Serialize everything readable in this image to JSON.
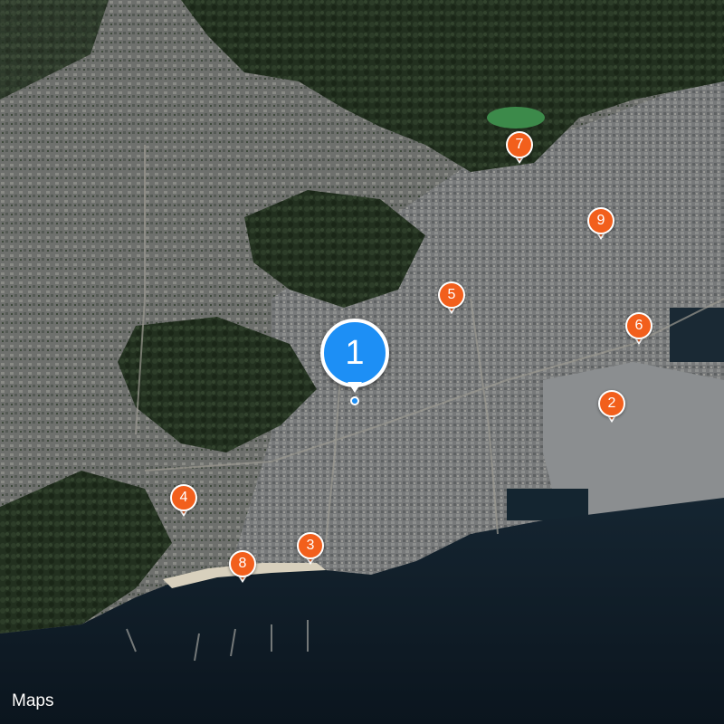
{
  "map": {
    "view": "satellite",
    "colors": {
      "pin_primary": "#1d8ff5",
      "pin_secondary": "#f25f1c",
      "water": "#0d1a24",
      "urban": "#6b6e70",
      "forest": "#1c2a1c"
    }
  },
  "pins": [
    {
      "label": "1",
      "kind": "primary"
    },
    {
      "label": "2",
      "kind": "secondary"
    },
    {
      "label": "3",
      "kind": "secondary"
    },
    {
      "label": "4",
      "kind": "secondary"
    },
    {
      "label": "5",
      "kind": "secondary"
    },
    {
      "label": "6",
      "kind": "secondary"
    },
    {
      "label": "7",
      "kind": "secondary"
    },
    {
      "label": "8",
      "kind": "secondary"
    },
    {
      "label": "9",
      "kind": "secondary"
    }
  ],
  "attribution": {
    "icon": "apple-logo-icon",
    "text": "Maps"
  }
}
